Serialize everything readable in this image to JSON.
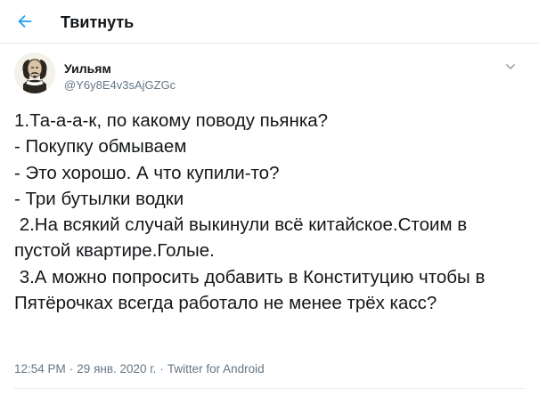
{
  "header": {
    "back_icon": "arrow-left-icon",
    "title": "Твитнуть"
  },
  "tweet": {
    "author": {
      "name": "Уильям",
      "handle": "@Y6y8E4v3sAjGZGc",
      "avatar_icon": "shakespeare-portrait-avatar"
    },
    "menu_icon": "chevron-down-icon",
    "text": "1.Та-а-а-к, по какому поводу пьянка?\n- Покупку обмываем\n- Это хорошо. А что купили-то?\n- Три бутылки водки\n 2.На всякий случай выкинули всё китайское.Стоим в пустой квартире.Голые.\n 3.А можно попросить добавить в Конституцию чтобы в Пятёрочках всегда работало не менее трёх касс?",
    "time": "12:54 PM",
    "separator": "·",
    "date": "29 янв. 2020 г.",
    "source": "Twitter for Android"
  },
  "colors": {
    "accent": "#1da1f2",
    "text": "#14171a",
    "secondary": "#657786",
    "border": "#e6ecf0"
  }
}
